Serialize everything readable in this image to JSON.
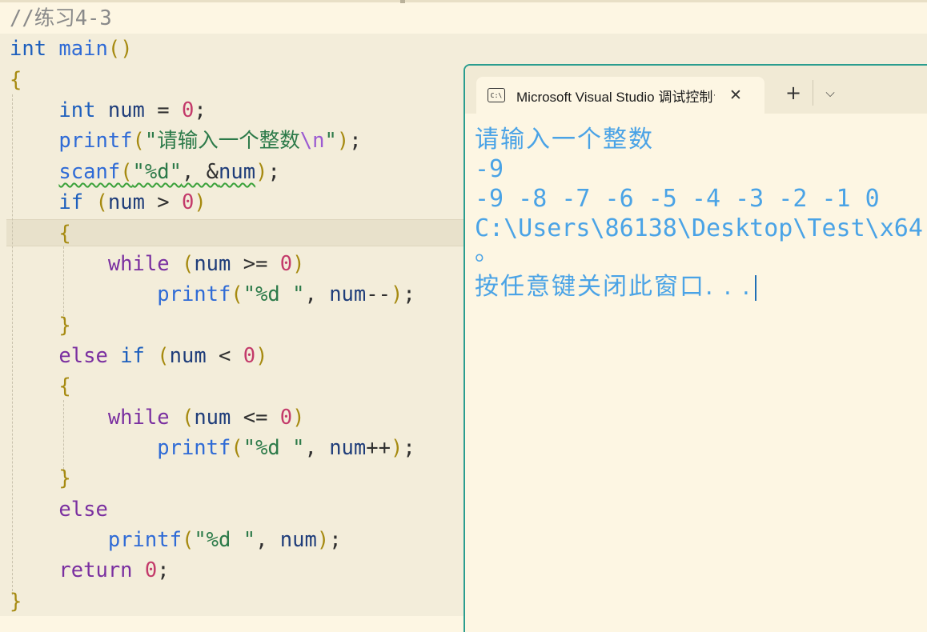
{
  "editor": {
    "lines": [
      [
        {
          "t": "//练习4-3",
          "c": "t-com"
        }
      ],
      [
        {
          "t": "int",
          "c": "t-kw-b"
        },
        {
          "t": " "
        },
        {
          "t": "main",
          "c": "t-fn"
        },
        {
          "t": "()",
          "c": "t-par"
        }
      ],
      [
        {
          "t": "{",
          "c": "t-par"
        }
      ],
      [
        {
          "t": "    "
        },
        {
          "t": "int",
          "c": "t-kw-b"
        },
        {
          "t": " "
        },
        {
          "t": "num",
          "c": "t-var"
        },
        {
          "t": " = ",
          "c": "t-pun"
        },
        {
          "t": "0",
          "c": "t-num"
        },
        {
          "t": ";",
          "c": "t-pun"
        }
      ],
      [
        {
          "t": "    "
        },
        {
          "t": "printf",
          "c": "t-fn"
        },
        {
          "t": "(",
          "c": "t-par"
        },
        {
          "t": "\"请输入一个整数",
          "c": "t-str"
        },
        {
          "t": "\\n",
          "c": "t-esc"
        },
        {
          "t": "\"",
          "c": "t-str"
        },
        {
          "t": ")",
          "c": "t-par"
        },
        {
          "t": ";",
          "c": "t-pun"
        }
      ],
      [
        {
          "t": "    "
        },
        {
          "t": "scanf",
          "c": "t-fn",
          "w": true
        },
        {
          "t": "(",
          "c": "t-par",
          "w": true
        },
        {
          "t": "\"%d\"",
          "c": "t-str",
          "w": true
        },
        {
          "t": ", &",
          "c": "t-pun",
          "w": true
        },
        {
          "t": "num",
          "c": "t-var",
          "w": true
        },
        {
          "t": ")",
          "c": "t-par"
        },
        {
          "t": ";",
          "c": "t-pun"
        }
      ],
      [
        {
          "t": "    "
        },
        {
          "t": "if",
          "c": "t-kw-b"
        },
        {
          "t": " "
        },
        {
          "t": "(",
          "c": "t-par"
        },
        {
          "t": "num",
          "c": "t-var"
        },
        {
          "t": " > ",
          "c": "t-pun"
        },
        {
          "t": "0",
          "c": "t-num"
        },
        {
          "t": ")",
          "c": "t-par"
        }
      ],
      [
        {
          "t": "    "
        },
        {
          "t": "{",
          "c": "t-par"
        }
      ],
      [
        {
          "t": "        "
        },
        {
          "t": "while",
          "c": "t-kw-p"
        },
        {
          "t": " "
        },
        {
          "t": "(",
          "c": "t-par"
        },
        {
          "t": "num",
          "c": "t-var"
        },
        {
          "t": " >= ",
          "c": "t-pun"
        },
        {
          "t": "0",
          "c": "t-num"
        },
        {
          "t": ")",
          "c": "t-par"
        }
      ],
      [
        {
          "t": "            "
        },
        {
          "t": "printf",
          "c": "t-fn"
        },
        {
          "t": "(",
          "c": "t-par"
        },
        {
          "t": "\"%d \"",
          "c": "t-str"
        },
        {
          "t": ", ",
          "c": "t-pun"
        },
        {
          "t": "num",
          "c": "t-var"
        },
        {
          "t": "--",
          "c": "t-pun"
        },
        {
          "t": ")",
          "c": "t-par"
        },
        {
          "t": ";",
          "c": "t-pun"
        }
      ],
      [
        {
          "t": "    "
        },
        {
          "t": "}",
          "c": "t-par"
        }
      ],
      [
        {
          "t": "    "
        },
        {
          "t": "else",
          "c": "t-kw-p"
        },
        {
          "t": " "
        },
        {
          "t": "if",
          "c": "t-kw-b"
        },
        {
          "t": " "
        },
        {
          "t": "(",
          "c": "t-par"
        },
        {
          "t": "num",
          "c": "t-var"
        },
        {
          "t": " < ",
          "c": "t-pun"
        },
        {
          "t": "0",
          "c": "t-num"
        },
        {
          "t": ")",
          "c": "t-par"
        }
      ],
      [
        {
          "t": "    "
        },
        {
          "t": "{",
          "c": "t-par"
        }
      ],
      [
        {
          "t": "        "
        },
        {
          "t": "while",
          "c": "t-kw-p"
        },
        {
          "t": " "
        },
        {
          "t": "(",
          "c": "t-par"
        },
        {
          "t": "num",
          "c": "t-var"
        },
        {
          "t": " <= ",
          "c": "t-pun"
        },
        {
          "t": "0",
          "c": "t-num"
        },
        {
          "t": ")",
          "c": "t-par"
        }
      ],
      [
        {
          "t": "            "
        },
        {
          "t": "printf",
          "c": "t-fn"
        },
        {
          "t": "(",
          "c": "t-par"
        },
        {
          "t": "\"%d \"",
          "c": "t-str"
        },
        {
          "t": ", ",
          "c": "t-pun"
        },
        {
          "t": "num",
          "c": "t-var"
        },
        {
          "t": "++",
          "c": "t-pun"
        },
        {
          "t": ")",
          "c": "t-par"
        },
        {
          "t": ";",
          "c": "t-pun"
        }
      ],
      [
        {
          "t": "    "
        },
        {
          "t": "}",
          "c": "t-par"
        }
      ],
      [
        {
          "t": "    "
        },
        {
          "t": "else",
          "c": "t-kw-p"
        }
      ],
      [
        {
          "t": "        "
        },
        {
          "t": "printf",
          "c": "t-fn"
        },
        {
          "t": "(",
          "c": "t-par"
        },
        {
          "t": "\"%d \"",
          "c": "t-str"
        },
        {
          "t": ", ",
          "c": "t-pun"
        },
        {
          "t": "num",
          "c": "t-var"
        },
        {
          "t": ")",
          "c": "t-par"
        },
        {
          "t": ";",
          "c": "t-pun"
        }
      ],
      [
        {
          "t": "    "
        },
        {
          "t": "return",
          "c": "t-kw-p"
        },
        {
          "t": " "
        },
        {
          "t": "0",
          "c": "t-num"
        },
        {
          "t": ";",
          "c": "t-pun"
        }
      ],
      [
        {
          "t": "}",
          "c": "t-par"
        }
      ]
    ]
  },
  "console": {
    "tab_icon": "C:\\",
    "tab_title": "Microsoft Visual Studio 调试控制台",
    "close_icon": "✕",
    "new_tab_icon": "+",
    "dropdown_icon": "⌵",
    "output": [
      "请输入一个整数",
      "-9",
      "-9 -8 -7 -6 -5 -4 -3 -2 -1 0",
      "C:\\Users\\86138\\Desktop\\Test\\x64",
      "。",
      "按任意键关闭此窗口. . ."
    ]
  },
  "colors": {
    "background": "#fdf6e3",
    "console_text": "#4aa3e6",
    "console_border": "#2a9d8f"
  }
}
